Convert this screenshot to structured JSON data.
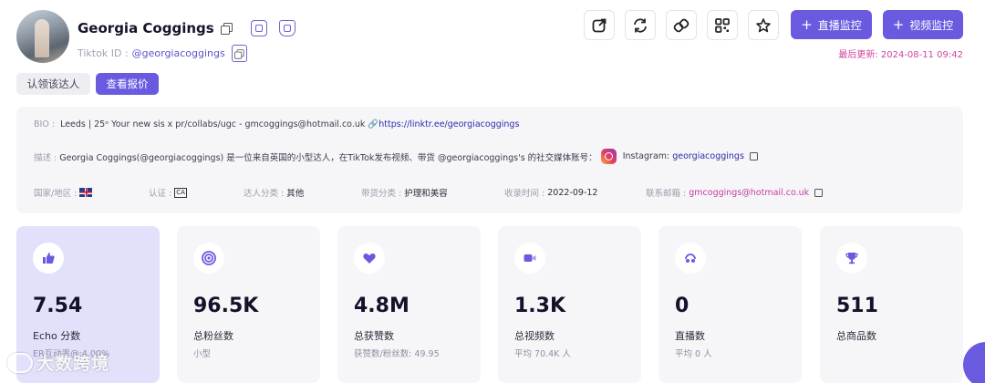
{
  "profile": {
    "name": "Georgia Coggings",
    "tiktok_id_label": "Tiktok ID :",
    "tiktok_id": "@georgiacoggings"
  },
  "buttons": {
    "claim": "认领该达人",
    "quote": "查看报价",
    "live_monitor": "直播监控",
    "video_monitor": "视频监控",
    "plus": "+"
  },
  "last_updated": "最后更新: 2024-08-11 09:42",
  "info": {
    "bio_label": "BIO :",
    "bio_text": "Leeds | 25ᵒ Your new sis x pr/collabs/ugc - gmcoggings@hotmail.co.uk 🔗",
    "bio_link": "https://linktr.ee/georgiacoggings",
    "desc_label": "描述 :",
    "desc_text": "Georgia Coggings(@georgiacoggings) 是一位来自英国的小型达人，在TikTok发布视频、带货 @georgiacoggings's 的社交媒体账号：",
    "instagram_label": "Instagram:",
    "instagram_handle": "georgiacoggings",
    "region_label": "国家/地区 :",
    "verify_label": "认证 :",
    "category_label": "达人分类 :",
    "category_value": "其他",
    "goods_label": "带货分类 :",
    "goods_value": "护理和美容",
    "collected_label": "收录时间 :",
    "collected_value": "2022-09-12",
    "email_label": "联系邮箱 :",
    "email_value": "gmcoggings@hotmail.co.uk",
    "flag_icon": "uk-flag-icon"
  },
  "stats": [
    {
      "value": "7.54",
      "label": "Echo 分数",
      "sub": "ER互动率@:4.00%",
      "icon": "thumbs-up-icon"
    },
    {
      "value": "96.5K",
      "label": "总粉丝数",
      "sub": "小型",
      "icon": "target-icon"
    },
    {
      "value": "4.8M",
      "label": "总获赞数",
      "sub": "获赞数/粉丝数: 49.95",
      "icon": "heart-icon"
    },
    {
      "value": "1.3K",
      "label": "总视频数",
      "sub": "平均 70.4K 人",
      "icon": "video-icon"
    },
    {
      "value": "0",
      "label": "直播数",
      "sub": "平均 0 人",
      "icon": "live-icon"
    },
    {
      "value": "511",
      "label": "总商品数",
      "sub": "",
      "icon": "trophy-icon"
    }
  ],
  "watermark": "大数跨境",
  "colors": {
    "accent": "#6a5ae0",
    "update_pink": "#d0459e",
    "active_card": "#e2e1fb"
  }
}
